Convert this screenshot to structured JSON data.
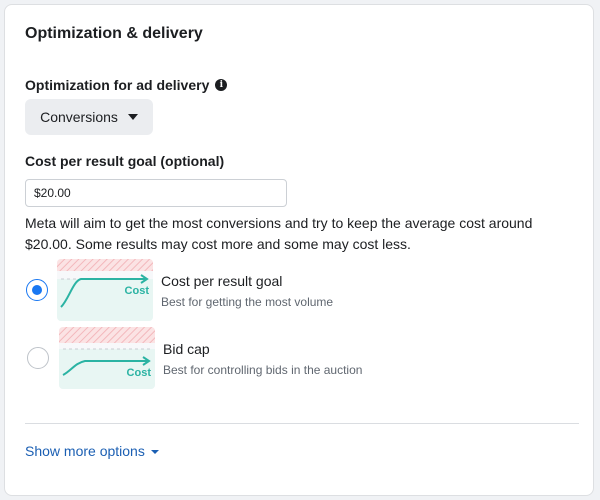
{
  "section": {
    "title": "Optimization & delivery"
  },
  "optimization": {
    "label": "Optimization for ad delivery",
    "info_icon": "info-icon",
    "selected": "Conversions",
    "dropdown_icon": "caret-down-icon"
  },
  "cost_goal": {
    "label": "Cost per result goal (optional)",
    "value": "$20.00",
    "helper": "Meta will aim to get the most conversions and try to keep the average cost around $20.00. Some results may cost more and some may cost less."
  },
  "strategies": [
    {
      "title": "Cost per result goal",
      "description": "Best for getting the most volume",
      "illustration_label": "Cost",
      "selected": true
    },
    {
      "title": "Bid cap",
      "description": "Best for controlling bids in the auction",
      "illustration_label": "Cost",
      "selected": false
    }
  ],
  "footer": {
    "more_options": "Show more options"
  },
  "colors": {
    "accent": "#1877f2",
    "link": "#1b5fb3",
    "illustration_line": "#2bb3a3",
    "illustration_band": "#f6c9cc"
  }
}
